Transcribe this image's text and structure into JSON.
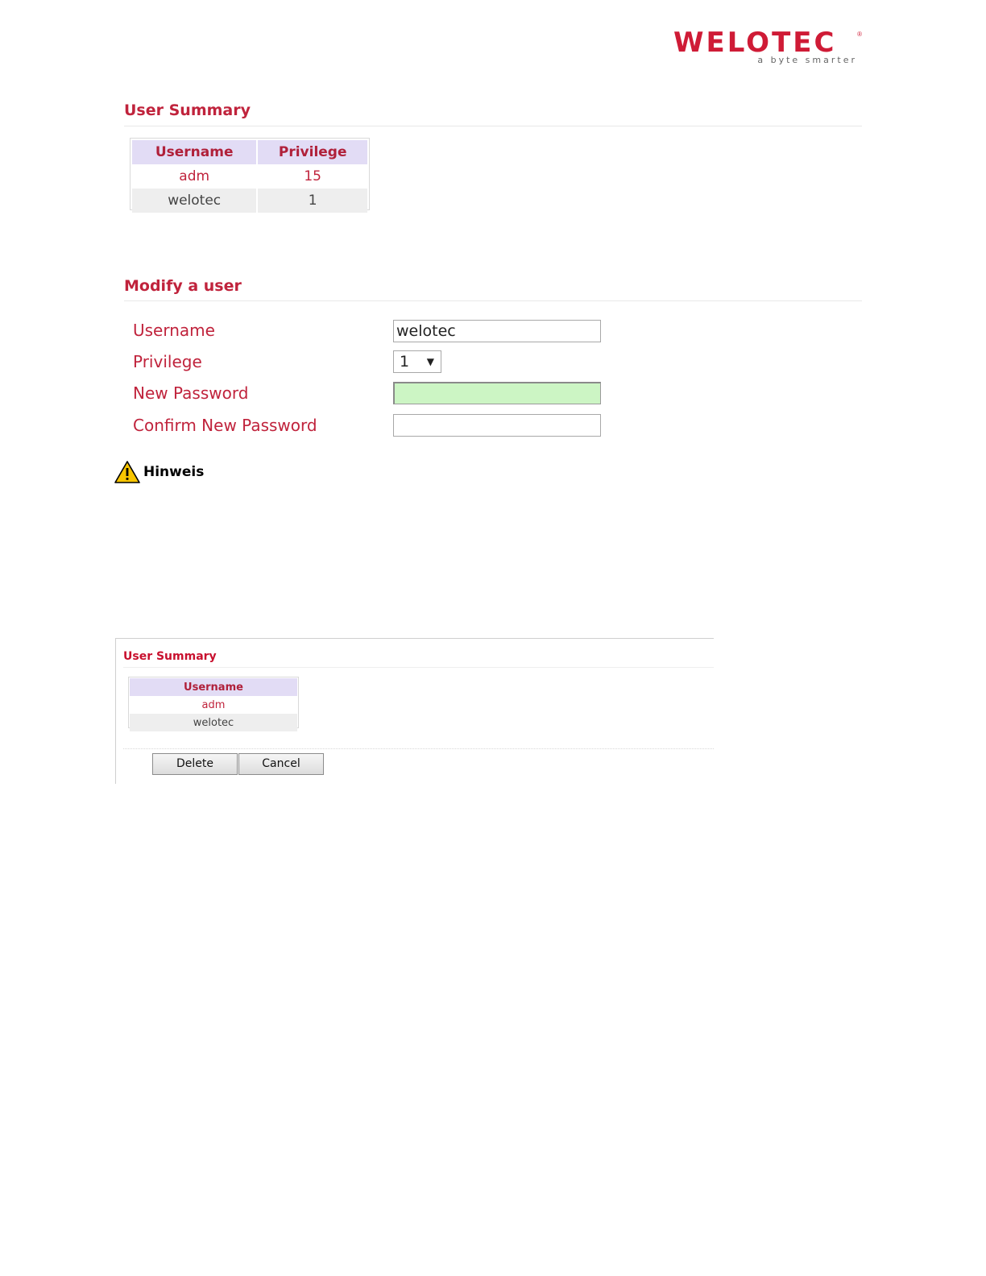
{
  "logo": {
    "word": "WELOTEC",
    "registered": "®",
    "tagline": "a byte smarter"
  },
  "user_summary": {
    "title": "User Summary",
    "headers": [
      "Username",
      "Privilege"
    ],
    "rows": [
      {
        "username": "adm",
        "privilege": "15"
      },
      {
        "username": "welotec",
        "privilege": "1"
      }
    ]
  },
  "modify_user": {
    "title": "Modify a user",
    "username_label": "Username",
    "username_value": "welotec",
    "privilege_label": "Privilege",
    "privilege_value": "1",
    "new_password_label": "New Password",
    "new_password_value": "",
    "confirm_password_label": "Confirm New Password",
    "confirm_password_value": ""
  },
  "hinweis": {
    "label": "Hinweis"
  },
  "delete_panel": {
    "title": "User Summary",
    "header": "Username",
    "rows": [
      "adm",
      "welotec"
    ],
    "delete_label": "Delete",
    "cancel_label": "Cancel"
  },
  "colors": {
    "brand": "#cf1b36",
    "table_header_bg": "#e2dcf5",
    "password_field_bg": "#ccf5c4",
    "warning_yellow": "#f7c500"
  }
}
